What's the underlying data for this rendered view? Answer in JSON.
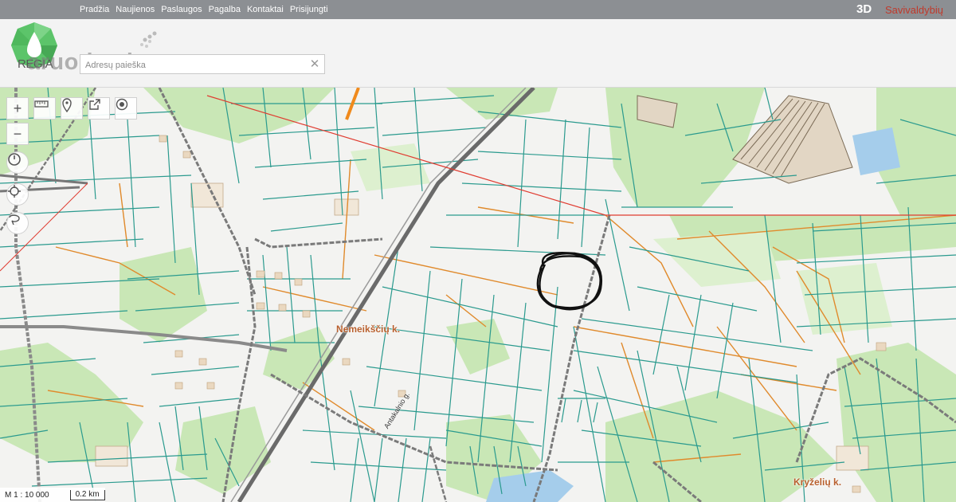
{
  "nav": {
    "items": [
      "Pradžia",
      "Naujienos",
      "Paslaugos",
      "Pagalba",
      "Kontaktai",
      "Prisijungti"
    ],
    "btn_3d": "3D",
    "municipalities": "Savivaldybių"
  },
  "logo": {
    "text": "REGIA"
  },
  "watermark": {
    "text": "aruodas.lt"
  },
  "search": {
    "placeholder": "Adresų paieška",
    "value": "",
    "clear_icon": "close-icon"
  },
  "map": {
    "place_labels": [
      "Nemeikščių k.",
      "Kryželių k."
    ],
    "street_labels": [
      "Antakalnio g."
    ],
    "scale_text": "M 1 : 10 000",
    "scale_bar": "0.2 km",
    "controls": [
      "zoom-in-icon",
      "zoom-out-icon",
      "history-icon",
      "locate-icon",
      "lasso-icon",
      "measure-icon",
      "marker-icon",
      "share-icon",
      "target-icon"
    ]
  },
  "colors": {
    "topbar": "#8c8f93",
    "parcel_line": "#2a9a8e",
    "forest": "#c8e6b4",
    "road": "#707070",
    "place_label": "#b8602e",
    "municipality_link": "#c0392b"
  }
}
